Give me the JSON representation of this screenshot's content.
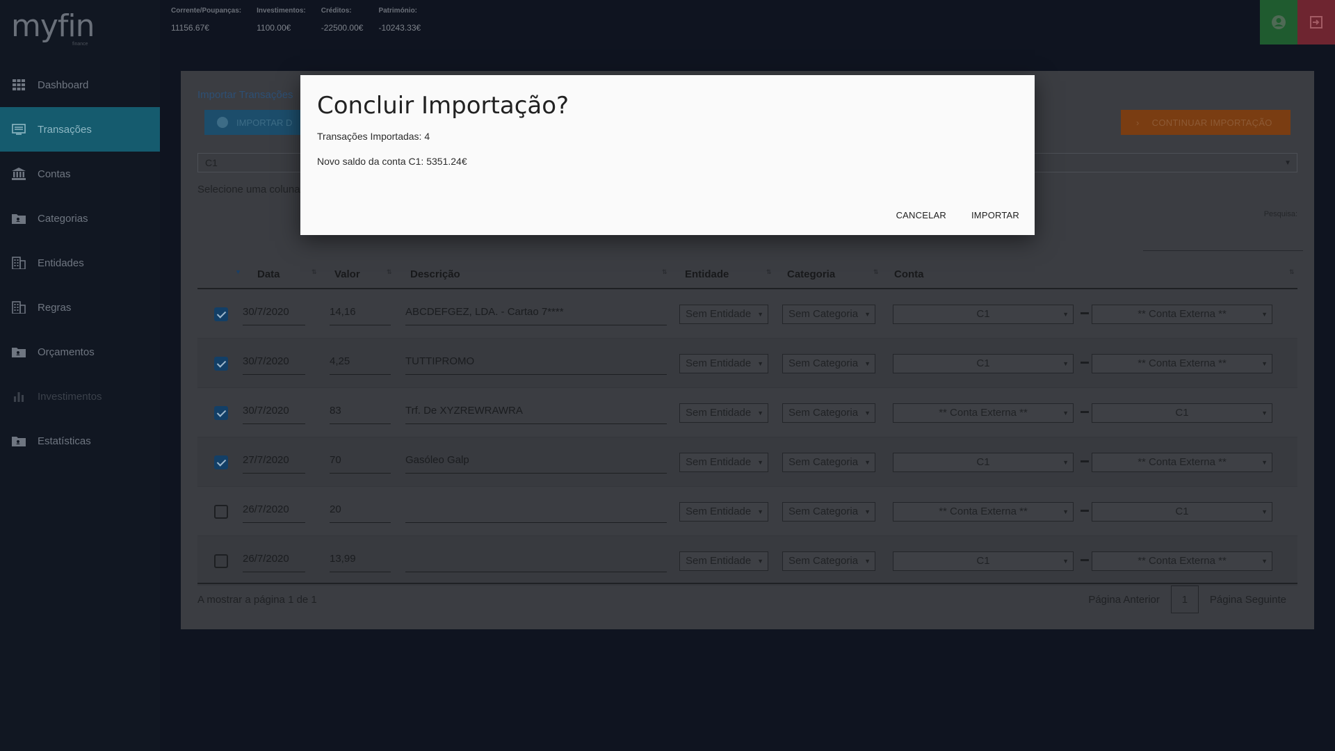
{
  "app": {
    "logo": "myfin",
    "logo_sub": "finance"
  },
  "sidebar": {
    "items": [
      {
        "label": "Dashboard",
        "icon": "grid-icon"
      },
      {
        "label": "Transações",
        "icon": "list-icon",
        "active": true
      },
      {
        "label": "Contas",
        "icon": "bank-icon"
      },
      {
        "label": "Categorias",
        "icon": "folder-icon"
      },
      {
        "label": "Entidades",
        "icon": "building-icon"
      },
      {
        "label": "Regras",
        "icon": "building-icon"
      },
      {
        "label": "Orçamentos",
        "icon": "folder-icon"
      },
      {
        "label": "Investimentos",
        "icon": "bar-chart-icon",
        "disabled": true
      },
      {
        "label": "Estatísticas",
        "icon": "folder-icon"
      }
    ]
  },
  "stats": [
    {
      "label": "Corrente/Poupanças:",
      "value": "11156.67€"
    },
    {
      "label": "Investimentos:",
      "value": "1100.00€"
    },
    {
      "label": "Créditos:",
      "value": "-22500.00€"
    },
    {
      "label": "Património:",
      "value": "-10243.33€"
    }
  ],
  "panel": {
    "breadcrumb": "Importar Transações",
    "import_button": "IMPORTAR D",
    "continue_button": "CONTINUAR IMPORTAÇÃO",
    "account_select": "C1",
    "select_column_text": "Selecione uma coluna",
    "search_label": "Pesquisa:"
  },
  "table": {
    "headers": {
      "date": "Data",
      "value": "Valor",
      "description": "Descrição",
      "entity": "Entidade",
      "category": "Categoria",
      "account": "Conta"
    },
    "rows": [
      {
        "checked": true,
        "date": "30/7/2020",
        "value": "14,16",
        "description": "ABCDEFGEZ, LDA. - Cartao 7****",
        "entity": "Sem Entidade",
        "category": "Sem Categoria",
        "from": "C1",
        "to": "** Conta Externa **"
      },
      {
        "checked": true,
        "date": "30/7/2020",
        "value": "4,25",
        "description": "TUTTIPROMO",
        "entity": "Sem Entidade",
        "category": "Sem Categoria",
        "from": "C1",
        "to": "** Conta Externa **"
      },
      {
        "checked": true,
        "date": "30/7/2020",
        "value": "83",
        "description": "Trf. De XYZREWRAWRA",
        "entity": "Sem Entidade",
        "category": "Sem Categoria",
        "from": "** Conta Externa **",
        "to": "C1"
      },
      {
        "checked": true,
        "date": "27/7/2020",
        "value": "70",
        "description": "Gasóleo Galp",
        "entity": "Sem Entidade",
        "category": "Sem Categoria",
        "from": "C1",
        "to": "** Conta Externa **"
      },
      {
        "checked": false,
        "date": "26/7/2020",
        "value": "20",
        "description": "",
        "entity": "Sem Entidade",
        "category": "Sem Categoria",
        "from": "** Conta Externa **",
        "to": "C1"
      },
      {
        "checked": false,
        "date": "26/7/2020",
        "value": "13,99",
        "description": "",
        "entity": "Sem Entidade",
        "category": "Sem Categoria",
        "from": "C1",
        "to": "** Conta Externa **"
      }
    ]
  },
  "pager": {
    "info": "A mostrar a página 1 de 1",
    "prev": "Página Anterior",
    "page": "1",
    "next": "Página Seguinte"
  },
  "modal": {
    "title": "Concluir Importação?",
    "line1": "Transações Importadas: 4",
    "line2": "Novo saldo da conta C1: 5351.24€",
    "cancel": "CANCELAR",
    "confirm": "IMPORTAR"
  }
}
